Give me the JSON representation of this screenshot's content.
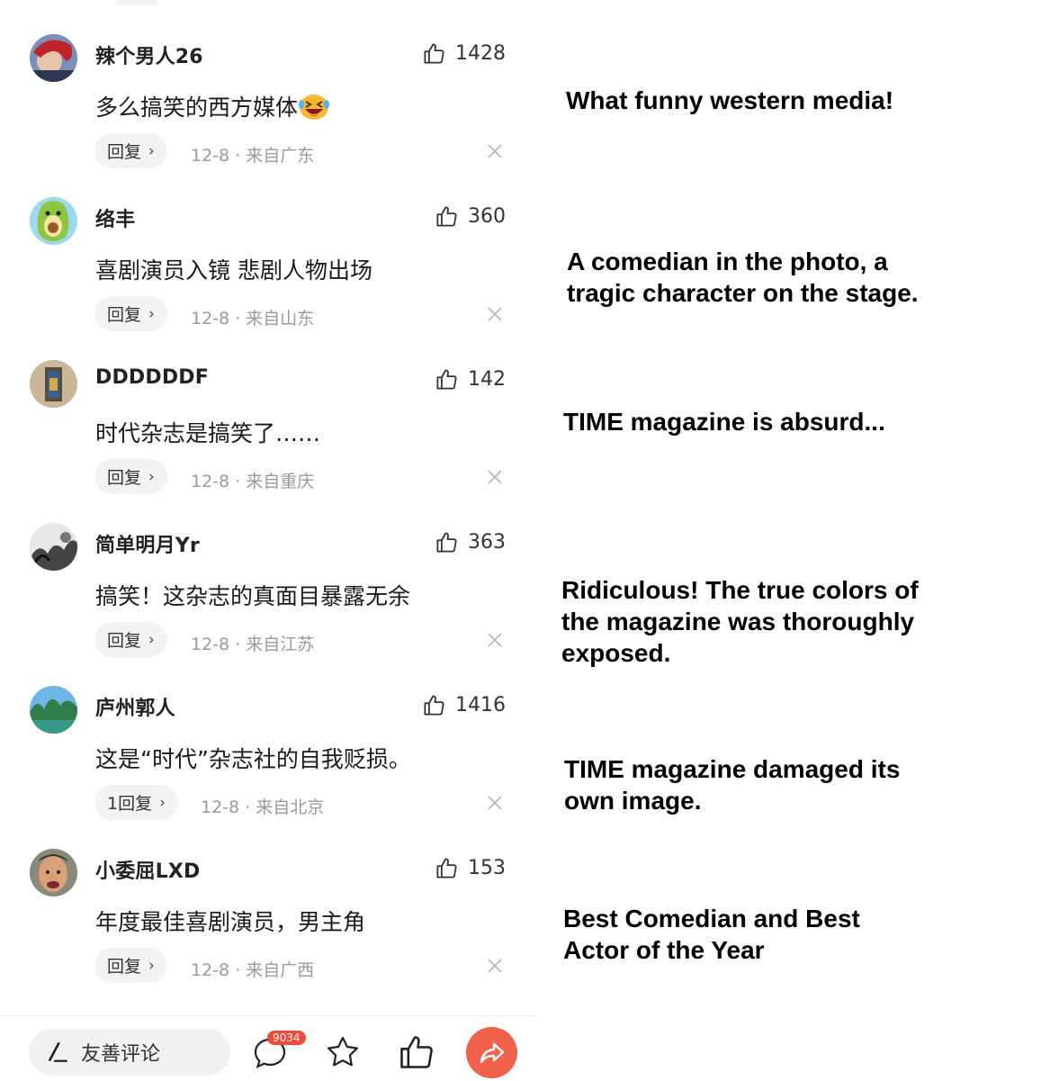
{
  "comments": [
    {
      "username": "辣个男人26",
      "likes": "1428",
      "text": "多么搞笑的西方媒体",
      "reply": "回复",
      "date": "12-8 · 来自广东",
      "translation": [
        "What funny western media!"
      ],
      "emoji": "laughing-crying-emoji"
    },
    {
      "username": "络丰",
      "likes": "360",
      "text": "喜剧演员入镜 悲剧人物出场",
      "reply": "回复",
      "date": "12-8 · 来自山东",
      "translation": [
        "A comedian in the photo, a",
        "tragic character on the stage."
      ]
    },
    {
      "username": "DDDDDDF",
      "likes": "142",
      "text": "时代杂志是搞笑了……",
      "reply": "回复",
      "date": "12-8 · 来自重庆",
      "translation": [
        "TIME magazine is absurd..."
      ]
    },
    {
      "username": "简单明月Yr",
      "likes": "363",
      "text": "搞笑！这杂志的真面目暴露无余",
      "reply": "回复",
      "date": "12-8 · 来自江苏",
      "translation": [
        "Ridiculous! The true colors of",
        "the magazine was thoroughly",
        "exposed."
      ]
    },
    {
      "username": "庐州郭人",
      "likes": "1416",
      "text": "这是“时代”杂志社的自我贬损。",
      "reply": "1回复",
      "date": "12-8 · 来自北京",
      "translation": [
        "TIME magazine damaged its",
        "own image."
      ]
    },
    {
      "username": "小委屈LXD",
      "likes": "153",
      "text": "年度最佳喜剧演员，男主角",
      "reply": "回复",
      "date": "12-8 · 来自广西",
      "translation": [
        "Best Comedian and Best",
        "Actor of the Year"
      ]
    }
  ],
  "bottom_bar": {
    "input_placeholder": "友善评论",
    "comment_count_badge": "9034",
    "icons": [
      "pencil-icon",
      "comment-icon",
      "star-icon",
      "thumbs-up-icon",
      "share-icon"
    ]
  },
  "colors": {
    "accent": "#f2614c",
    "badge": "#f04a3a",
    "meta_text": "#9a9a9a",
    "pill_bg": "#f3f3f3"
  }
}
